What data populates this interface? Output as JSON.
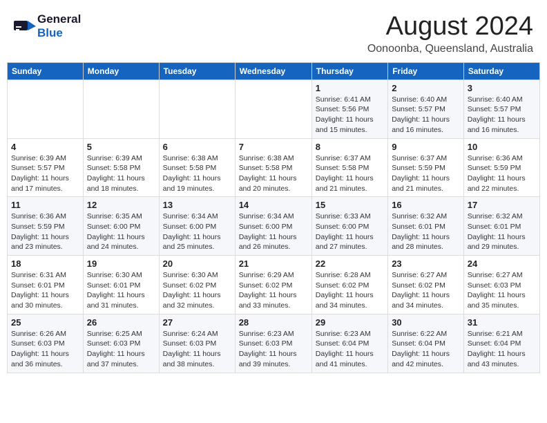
{
  "header": {
    "logo_general": "General",
    "logo_blue": "Blue",
    "month": "August 2024",
    "location": "Oonoonba, Queensland, Australia"
  },
  "weekdays": [
    "Sunday",
    "Monday",
    "Tuesday",
    "Wednesday",
    "Thursday",
    "Friday",
    "Saturday"
  ],
  "weeks": [
    [
      {
        "day": "",
        "info": ""
      },
      {
        "day": "",
        "info": ""
      },
      {
        "day": "",
        "info": ""
      },
      {
        "day": "",
        "info": ""
      },
      {
        "day": "1",
        "info": "Sunrise: 6:41 AM\nSunset: 5:56 PM\nDaylight: 11 hours and 15 minutes."
      },
      {
        "day": "2",
        "info": "Sunrise: 6:40 AM\nSunset: 5:57 PM\nDaylight: 11 hours and 16 minutes."
      },
      {
        "day": "3",
        "info": "Sunrise: 6:40 AM\nSunset: 5:57 PM\nDaylight: 11 hours and 16 minutes."
      }
    ],
    [
      {
        "day": "4",
        "info": "Sunrise: 6:39 AM\nSunset: 5:57 PM\nDaylight: 11 hours and 17 minutes."
      },
      {
        "day": "5",
        "info": "Sunrise: 6:39 AM\nSunset: 5:58 PM\nDaylight: 11 hours and 18 minutes."
      },
      {
        "day": "6",
        "info": "Sunrise: 6:38 AM\nSunset: 5:58 PM\nDaylight: 11 hours and 19 minutes."
      },
      {
        "day": "7",
        "info": "Sunrise: 6:38 AM\nSunset: 5:58 PM\nDaylight: 11 hours and 20 minutes."
      },
      {
        "day": "8",
        "info": "Sunrise: 6:37 AM\nSunset: 5:58 PM\nDaylight: 11 hours and 21 minutes."
      },
      {
        "day": "9",
        "info": "Sunrise: 6:37 AM\nSunset: 5:59 PM\nDaylight: 11 hours and 21 minutes."
      },
      {
        "day": "10",
        "info": "Sunrise: 6:36 AM\nSunset: 5:59 PM\nDaylight: 11 hours and 22 minutes."
      }
    ],
    [
      {
        "day": "11",
        "info": "Sunrise: 6:36 AM\nSunset: 5:59 PM\nDaylight: 11 hours and 23 minutes."
      },
      {
        "day": "12",
        "info": "Sunrise: 6:35 AM\nSunset: 6:00 PM\nDaylight: 11 hours and 24 minutes."
      },
      {
        "day": "13",
        "info": "Sunrise: 6:34 AM\nSunset: 6:00 PM\nDaylight: 11 hours and 25 minutes."
      },
      {
        "day": "14",
        "info": "Sunrise: 6:34 AM\nSunset: 6:00 PM\nDaylight: 11 hours and 26 minutes."
      },
      {
        "day": "15",
        "info": "Sunrise: 6:33 AM\nSunset: 6:00 PM\nDaylight: 11 hours and 27 minutes."
      },
      {
        "day": "16",
        "info": "Sunrise: 6:32 AM\nSunset: 6:01 PM\nDaylight: 11 hours and 28 minutes."
      },
      {
        "day": "17",
        "info": "Sunrise: 6:32 AM\nSunset: 6:01 PM\nDaylight: 11 hours and 29 minutes."
      }
    ],
    [
      {
        "day": "18",
        "info": "Sunrise: 6:31 AM\nSunset: 6:01 PM\nDaylight: 11 hours and 30 minutes."
      },
      {
        "day": "19",
        "info": "Sunrise: 6:30 AM\nSunset: 6:01 PM\nDaylight: 11 hours and 31 minutes."
      },
      {
        "day": "20",
        "info": "Sunrise: 6:30 AM\nSunset: 6:02 PM\nDaylight: 11 hours and 32 minutes."
      },
      {
        "day": "21",
        "info": "Sunrise: 6:29 AM\nSunset: 6:02 PM\nDaylight: 11 hours and 33 minutes."
      },
      {
        "day": "22",
        "info": "Sunrise: 6:28 AM\nSunset: 6:02 PM\nDaylight: 11 hours and 34 minutes."
      },
      {
        "day": "23",
        "info": "Sunrise: 6:27 AM\nSunset: 6:02 PM\nDaylight: 11 hours and 34 minutes."
      },
      {
        "day": "24",
        "info": "Sunrise: 6:27 AM\nSunset: 6:03 PM\nDaylight: 11 hours and 35 minutes."
      }
    ],
    [
      {
        "day": "25",
        "info": "Sunrise: 6:26 AM\nSunset: 6:03 PM\nDaylight: 11 hours and 36 minutes."
      },
      {
        "day": "26",
        "info": "Sunrise: 6:25 AM\nSunset: 6:03 PM\nDaylight: 11 hours and 37 minutes."
      },
      {
        "day": "27",
        "info": "Sunrise: 6:24 AM\nSunset: 6:03 PM\nDaylight: 11 hours and 38 minutes."
      },
      {
        "day": "28",
        "info": "Sunrise: 6:23 AM\nSunset: 6:03 PM\nDaylight: 11 hours and 39 minutes."
      },
      {
        "day": "29",
        "info": "Sunrise: 6:23 AM\nSunset: 6:04 PM\nDaylight: 11 hours and 41 minutes."
      },
      {
        "day": "30",
        "info": "Sunrise: 6:22 AM\nSunset: 6:04 PM\nDaylight: 11 hours and 42 minutes."
      },
      {
        "day": "31",
        "info": "Sunrise: 6:21 AM\nSunset: 6:04 PM\nDaylight: 11 hours and 43 minutes."
      }
    ]
  ]
}
